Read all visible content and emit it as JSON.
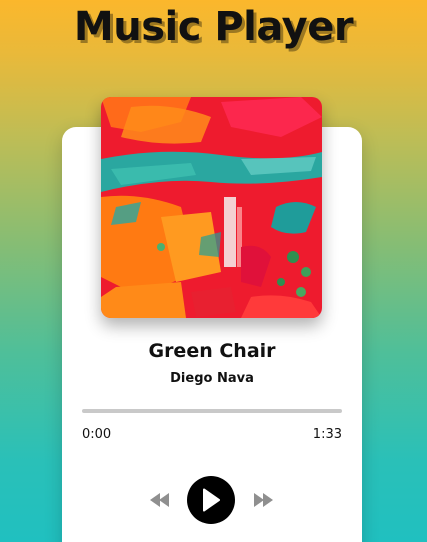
{
  "app": {
    "title": "Music Player"
  },
  "track": {
    "title": "Green Chair",
    "artist": "Diego Nava",
    "current_time": "0:00",
    "duration": "1:33",
    "progress_fraction": 0
  },
  "controls": {
    "prev_icon": "rewind-icon",
    "play_icon": "play-icon",
    "next_icon": "fast-forward-icon"
  },
  "colors": {
    "gradient_top": "#fbb72c",
    "gradient_bottom": "#20c0c0",
    "card": "#ffffff",
    "play_button": "#000000",
    "progress_track": "#c9c9c9"
  }
}
